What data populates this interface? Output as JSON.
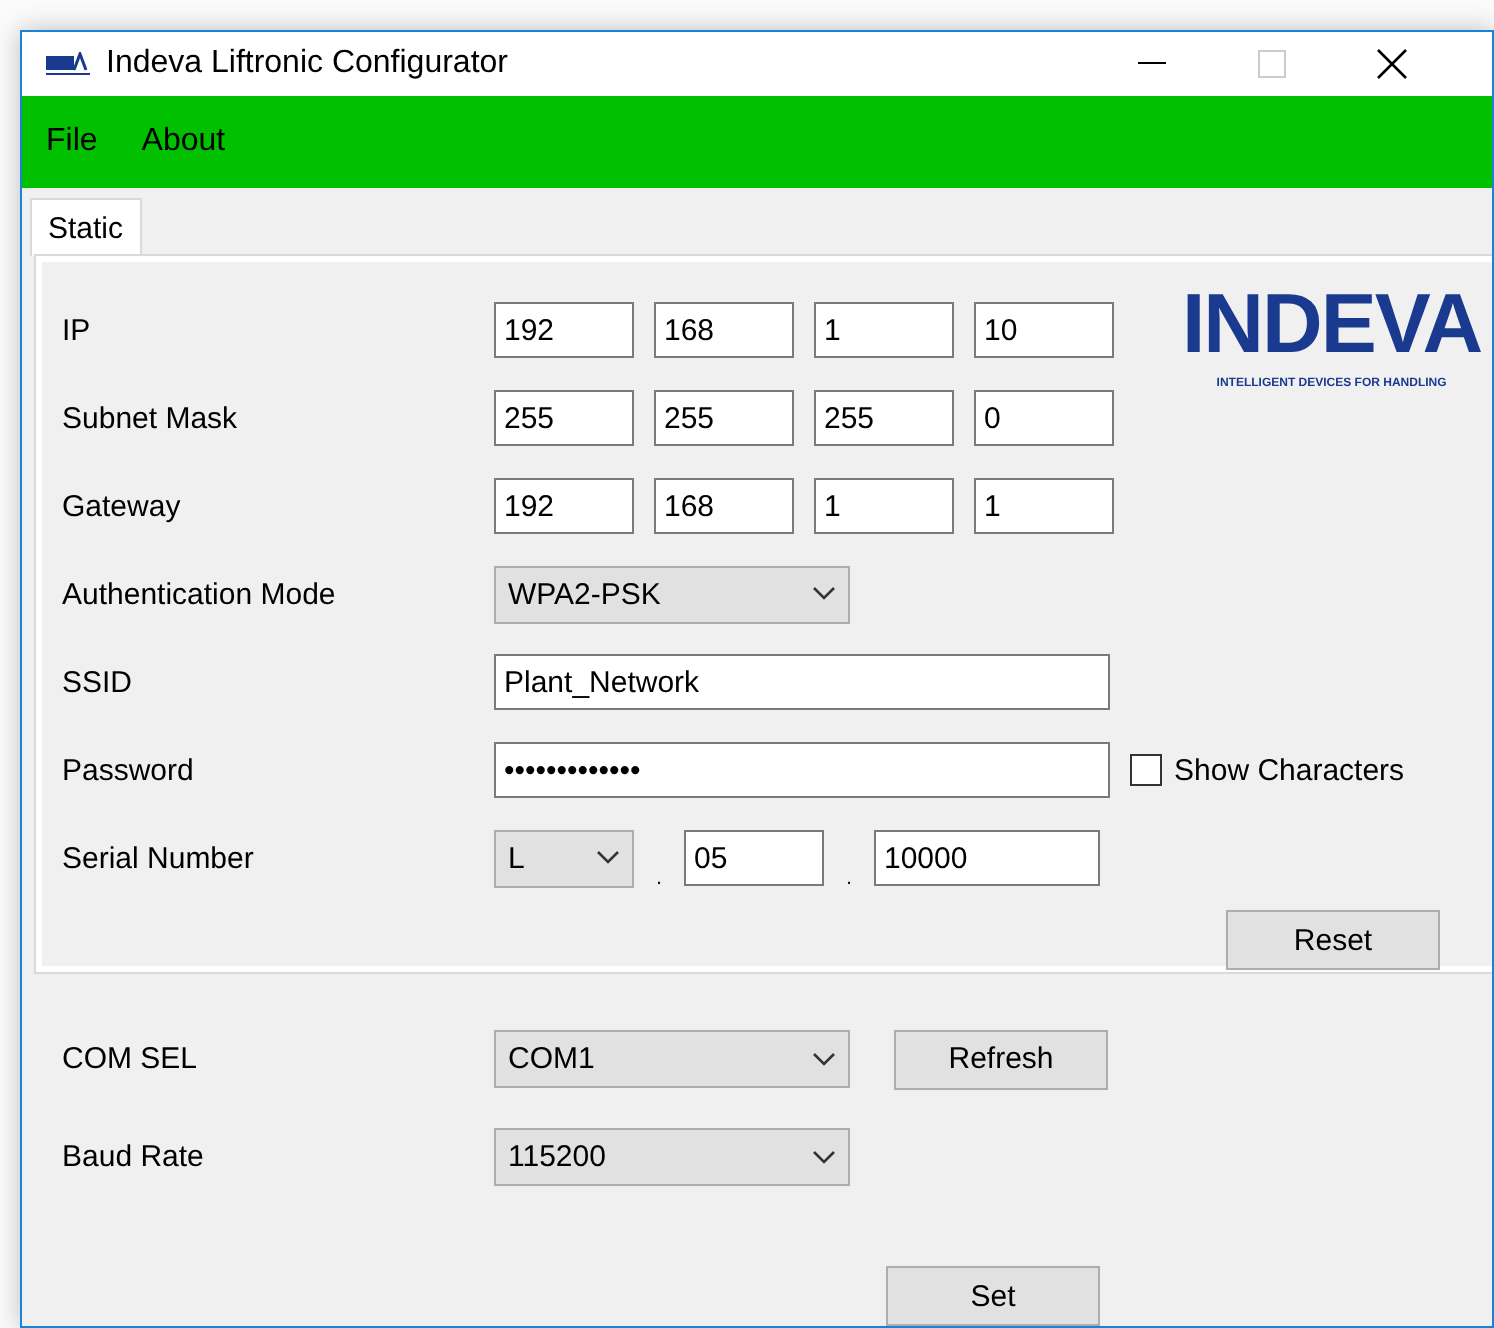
{
  "window": {
    "title": "Indeva Liftronic Configurator"
  },
  "menu": [
    "File",
    "About"
  ],
  "tabs": [
    {
      "label": "Static",
      "selected": true
    }
  ],
  "logo": {
    "name": "INDEVA",
    "tagline": "INTELLIGENT DEVICES FOR HANDLING"
  },
  "static_fields": [
    {
      "kind": "octets",
      "label": "IP",
      "values": [
        "192",
        "168",
        "1",
        "10"
      ]
    },
    {
      "kind": "octets",
      "label": "Subnet Mask",
      "values": [
        "255",
        "255",
        "255",
        "0"
      ]
    },
    {
      "kind": "octets",
      "label": "Gateway",
      "values": [
        "192",
        "168",
        "1",
        "1"
      ]
    },
    {
      "kind": "dropdown",
      "label": "Authentication Mode",
      "value": "WPA2-PSK"
    },
    {
      "kind": "text",
      "label": "SSID",
      "value": "Plant_Network"
    },
    {
      "kind": "password",
      "label": "Password",
      "value": "•••••••••••••",
      "checkbox": {
        "label": "Show Characters",
        "checked": false
      }
    },
    {
      "kind": "serial",
      "label": "Serial Number",
      "prefix": "L",
      "separator": ".",
      "parts": [
        "05",
        "10000"
      ]
    }
  ],
  "reset_button": "Reset",
  "serial_settings": [
    {
      "label": "COM SEL",
      "value": "COM1",
      "button": "Refresh"
    },
    {
      "label": "Baud Rate",
      "value": "115200"
    }
  ],
  "set_button": "Set"
}
